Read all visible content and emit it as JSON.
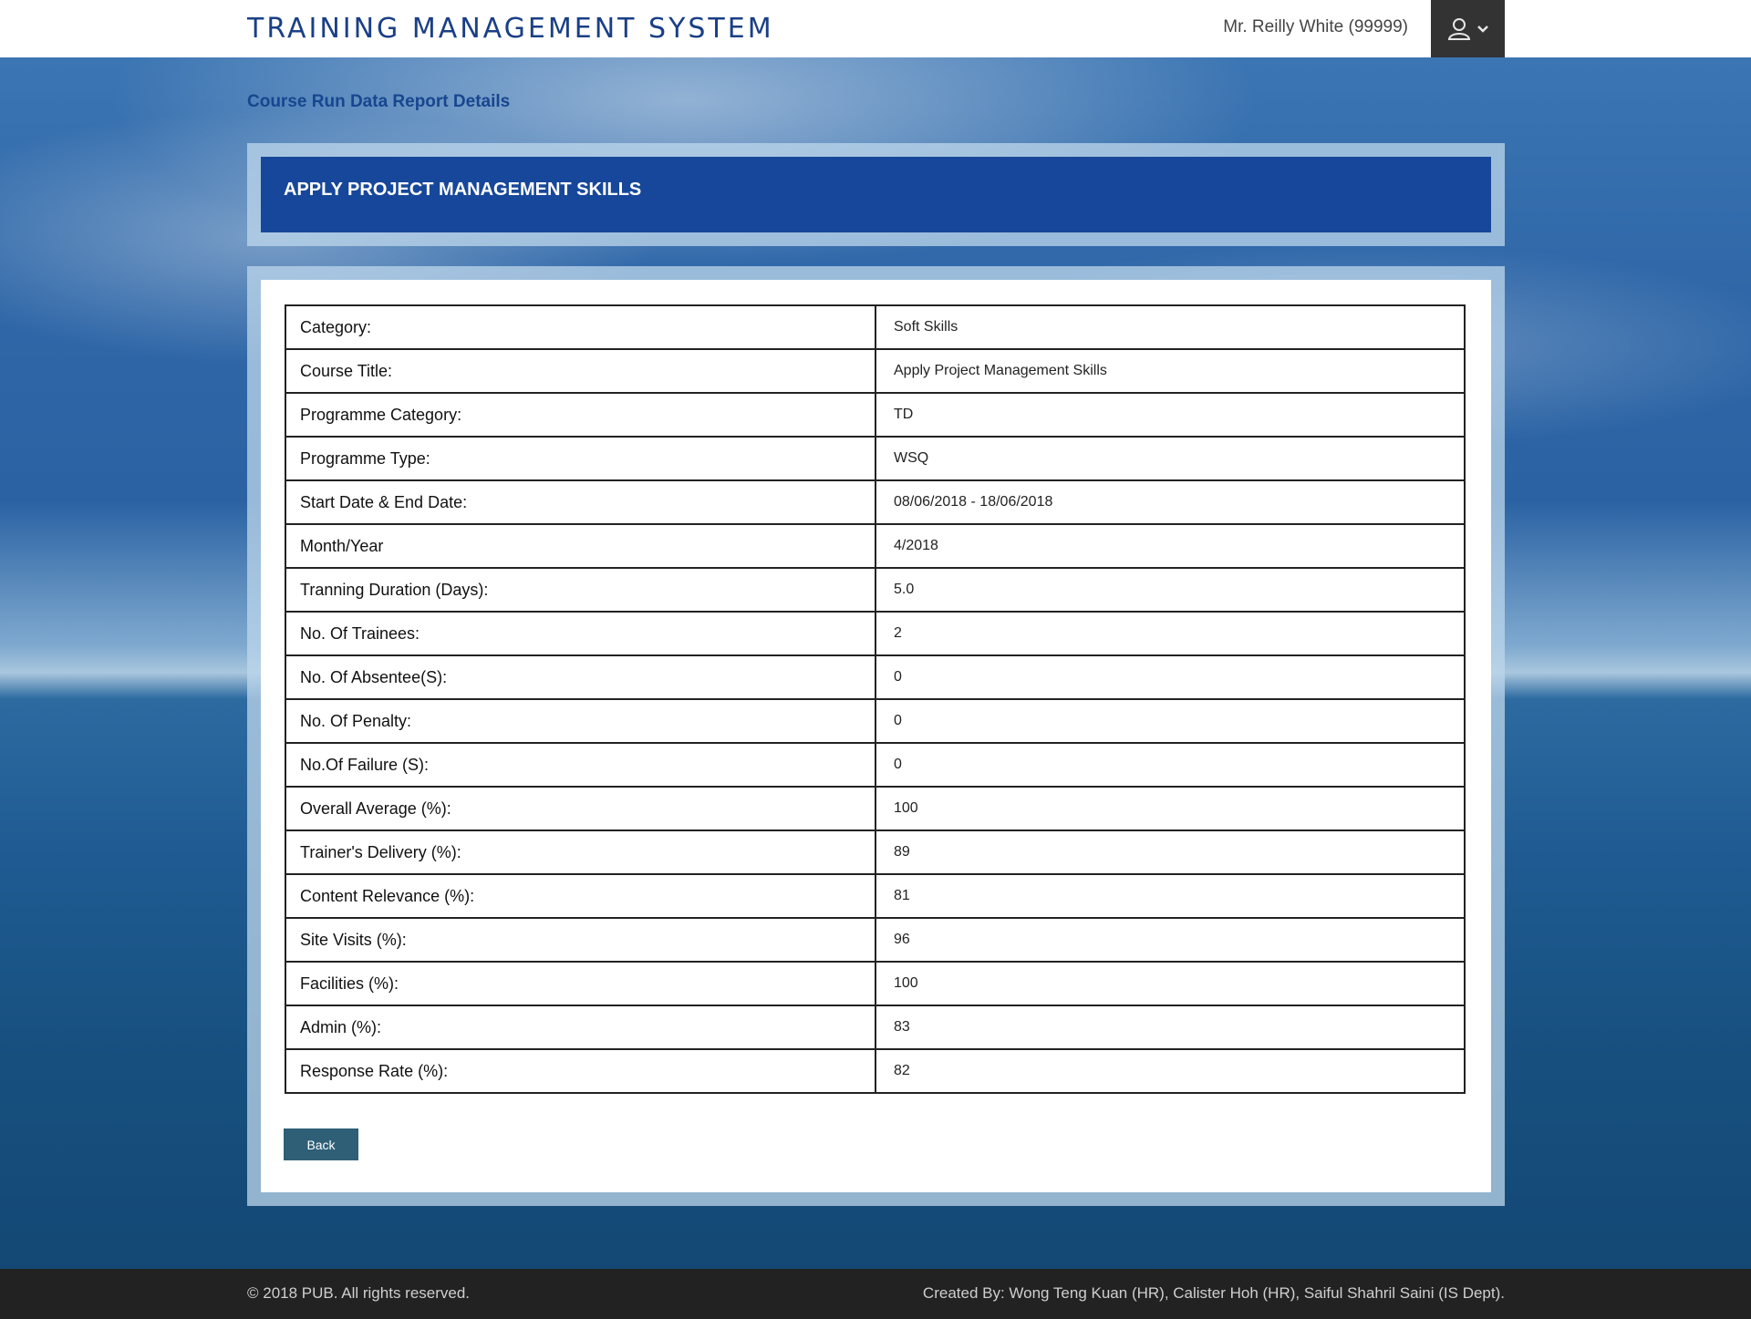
{
  "header": {
    "app_title": "TRAINING MANAGEMENT SYSTEM",
    "user_name": "Mr. Reilly White (99999)",
    "user_menu_icon": "user-icon",
    "dropdown_icon": "chevron-down-icon"
  },
  "breadcrumb": "Course Run Data Report Details",
  "course_heading": "APPLY PROJECT MANAGEMENT SKILLS",
  "report": {
    "rows": [
      {
        "label": "Category:",
        "value": "Soft Skills"
      },
      {
        "label": "Course Title:",
        "value": "Apply Project Management Skills"
      },
      {
        "label": "Programme Category:",
        "value": "TD"
      },
      {
        "label": "Programme Type:",
        "value": "WSQ"
      },
      {
        "label": "Start Date & End Date:",
        "value": "08/06/2018 - 18/06/2018"
      },
      {
        "label": "Month/Year",
        "value": "4/2018"
      },
      {
        "label": "Tranning Duration (Days):",
        "value": "5.0"
      },
      {
        "label": "No. Of Trainees:",
        "value": "2"
      },
      {
        "label": "No. Of Absentee(S):",
        "value": "0"
      },
      {
        "label": "No. Of Penalty:",
        "value": "0"
      },
      {
        "label": "No.Of Failure (S):",
        "value": "0"
      },
      {
        "label": "Overall Average (%):",
        "value": "100"
      },
      {
        "label": "Trainer's Delivery (%):",
        "value": "89"
      },
      {
        "label": "Content Relevance (%):",
        "value": "81"
      },
      {
        "label": "Site Visits (%):",
        "value": "96"
      },
      {
        "label": "Facilities (%):",
        "value": "100"
      },
      {
        "label": "Admin (%):",
        "value": "83"
      },
      {
        "label": "Response Rate (%):",
        "value": "82"
      }
    ]
  },
  "actions": {
    "back_label": "Back"
  },
  "footer": {
    "copyright": "© 2018 PUB. All rights reserved.",
    "credits": "Created By: Wong Teng Kuan (HR), Calister Hoh (HR), Saiful Shahril Saini (IS Dept)."
  },
  "colors": {
    "brand": "#1a3f86",
    "title_bar": "#17479a",
    "back_button": "#2e5f77",
    "footer_bg": "#222222"
  }
}
